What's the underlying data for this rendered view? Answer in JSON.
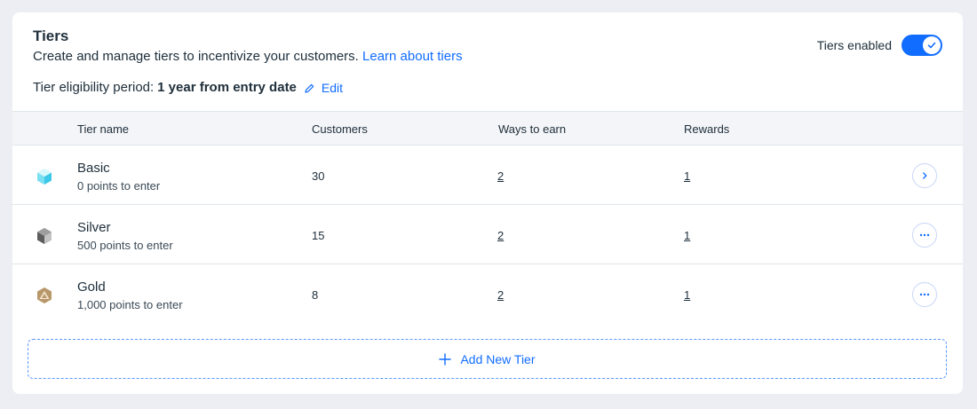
{
  "header": {
    "title": "Tiers",
    "subtitle": "Create and manage tiers to incentivize your customers.",
    "learn_link": "Learn about tiers",
    "eligibility_label": "Tier eligibility period:",
    "eligibility_value": "1 year from entry date",
    "edit_label": "Edit"
  },
  "toggle": {
    "label": "Tiers enabled",
    "enabled": true
  },
  "table": {
    "columns": [
      "Tier name",
      "Customers",
      "Ways to earn",
      "Rewards"
    ],
    "rows": [
      {
        "name": "Basic",
        "points": "0 points to enter",
        "customers": "30",
        "ways_to_earn": "2",
        "rewards": "1",
        "icon": "basic-tier-icon",
        "action": "chevron-right-icon"
      },
      {
        "name": "Silver",
        "points": "500 points to enter",
        "customers": "15",
        "ways_to_earn": "2",
        "rewards": "1",
        "icon": "silver-tier-icon",
        "action": "more-options-icon"
      },
      {
        "name": "Gold",
        "points": "1,000 points to enter",
        "customers": "8",
        "ways_to_earn": "2",
        "rewards": "1",
        "icon": "gold-tier-icon",
        "action": "more-options-icon"
      }
    ]
  },
  "add_tier_label": "Add New Tier",
  "colors": {
    "accent": "#116dff",
    "background": "#eceef3",
    "card": "#ffffff",
    "header_row": "#f4f5f8"
  }
}
